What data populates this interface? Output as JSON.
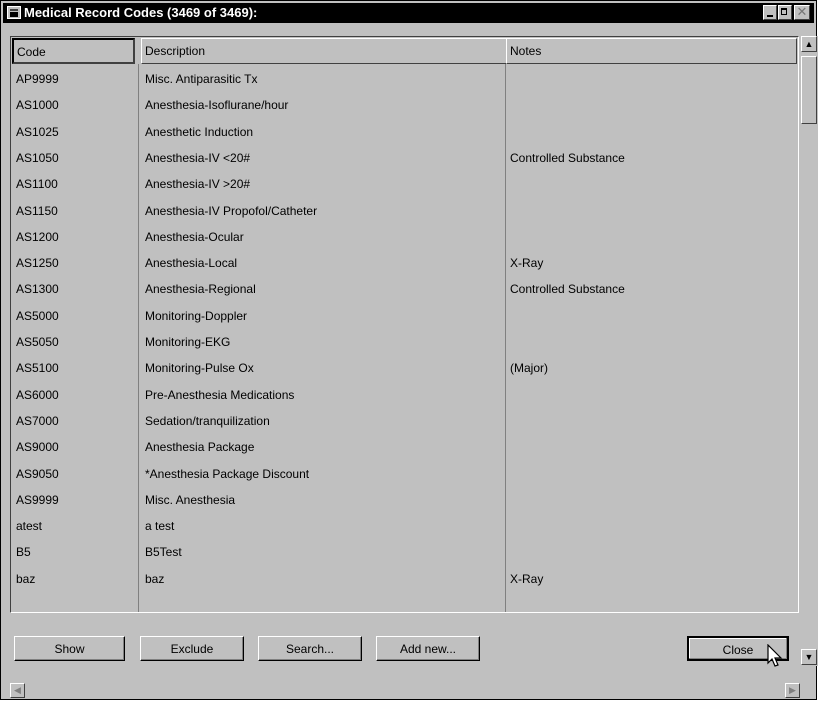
{
  "window": {
    "title": "Medical Record Codes (3469 of 3469):",
    "controls": [
      "minimize-icon",
      "maximize-icon",
      "close-icon"
    ]
  },
  "table": {
    "columns": [
      "Code",
      "Description",
      "Notes"
    ],
    "rows": [
      [
        "AP9999",
        "Misc. Antiparasitic Tx",
        ""
      ],
      [
        "AS1000",
        "Anesthesia-Isoflurane/hour",
        ""
      ],
      [
        "AS1025",
        "Anesthetic Induction",
        ""
      ],
      [
        "AS1050",
        "Anesthesia-IV <20#",
        "Controlled Substance"
      ],
      [
        "AS1100",
        "Anesthesia-IV >20#",
        ""
      ],
      [
        "AS1150",
        "Anesthesia-IV Propofol/Catheter",
        ""
      ],
      [
        "AS1200",
        "Anesthesia-Ocular",
        ""
      ],
      [
        "AS1250",
        "Anesthesia-Local",
        "X-Ray"
      ],
      [
        "AS1300",
        "Anesthesia-Regional",
        "Controlled Substance"
      ],
      [
        "AS5000",
        "Monitoring-Doppler",
        ""
      ],
      [
        "AS5050",
        "Monitoring-EKG",
        ""
      ],
      [
        "AS5100",
        "Monitoring-Pulse Ox",
        "(Major)"
      ],
      [
        "AS6000",
        "Pre-Anesthesia Medications",
        ""
      ],
      [
        "AS7000",
        "Sedation/tranquilization",
        ""
      ],
      [
        "AS9000",
        "Anesthesia Package",
        ""
      ],
      [
        "AS9050",
        "*Anesthesia Package Discount",
        ""
      ],
      [
        "AS9999",
        "Misc. Anesthesia",
        ""
      ],
      [
        "atest",
        "a test",
        ""
      ],
      [
        "B5",
        "B5Test",
        ""
      ],
      [
        "baz",
        "baz",
        "X-Ray"
      ]
    ]
  },
  "buttons": {
    "show": "Show",
    "exclude": "Exclude",
    "search": "Search...",
    "add_new": "Add new...",
    "close": "Close"
  },
  "colors": {
    "titlebar": "#000000",
    "title_text": "#ffffff",
    "face": "#c0c0c0"
  }
}
